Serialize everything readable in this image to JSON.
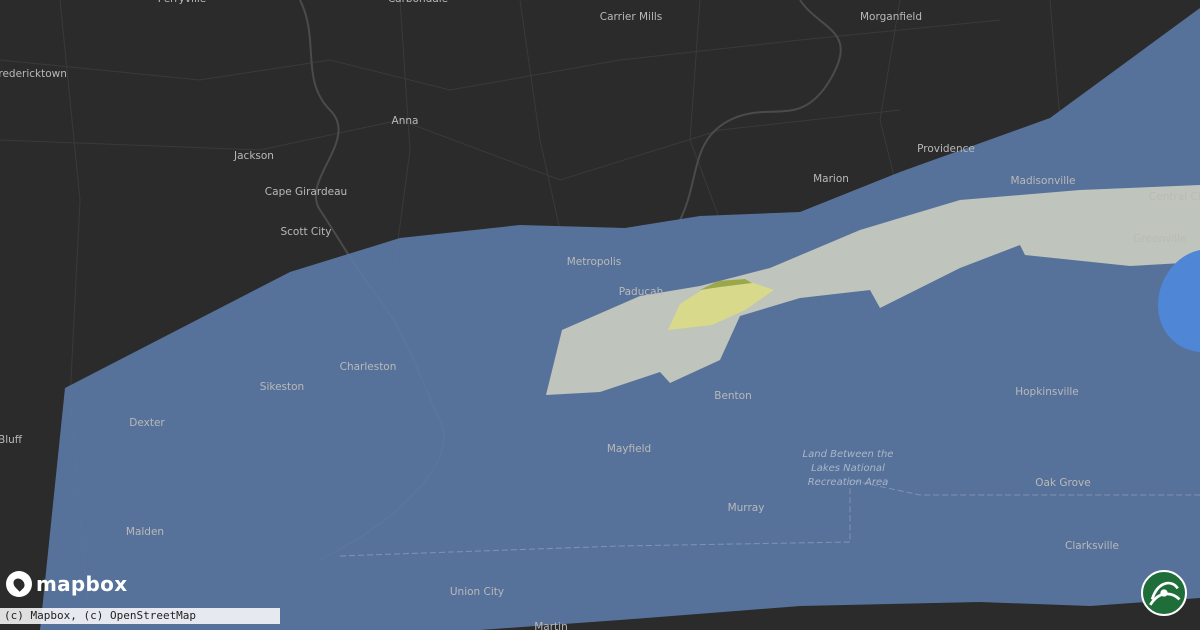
{
  "map": {
    "places": [
      {
        "id": "perryville",
        "label": "Perryville"
      },
      {
        "id": "carbondale",
        "label": "Carbondale"
      },
      {
        "id": "carrier-mills",
        "label": "Carrier Mills"
      },
      {
        "id": "morganfield",
        "label": "Morganfield"
      },
      {
        "id": "fredericktown",
        "label": "Fredericktown"
      },
      {
        "id": "anna",
        "label": "Anna"
      },
      {
        "id": "jackson",
        "label": "Jackson"
      },
      {
        "id": "cape-girardeau",
        "label": "Cape Girardeau"
      },
      {
        "id": "providence",
        "label": "Providence"
      },
      {
        "id": "marion",
        "label": "Marion"
      },
      {
        "id": "madisonville",
        "label": "Madisonville"
      },
      {
        "id": "central-city",
        "label": "Central City"
      },
      {
        "id": "scott-city",
        "label": "Scott City"
      },
      {
        "id": "metropolis",
        "label": "Metropolis"
      },
      {
        "id": "greenville",
        "label": "Greenville"
      },
      {
        "id": "paducah",
        "label": "Paducah"
      },
      {
        "id": "charleston",
        "label": "Charleston"
      },
      {
        "id": "sikeston",
        "label": "Sikeston"
      },
      {
        "id": "benton",
        "label": "Benton"
      },
      {
        "id": "hopkinsville",
        "label": "Hopkinsville"
      },
      {
        "id": "dexter",
        "label": "Dexter"
      },
      {
        "id": "bluff",
        "label": "Bluff"
      },
      {
        "id": "mayfield",
        "label": "Mayfield"
      },
      {
        "id": "oak-grove",
        "label": "Oak Grove"
      },
      {
        "id": "murray",
        "label": "Murray"
      },
      {
        "id": "malden",
        "label": "Malden"
      },
      {
        "id": "clarksville",
        "label": "Clarksville"
      },
      {
        "id": "union-city",
        "label": "Union City"
      },
      {
        "id": "martin",
        "label": "Martin"
      }
    ],
    "park_label": [
      "Land Between the",
      "Lakes National",
      "Recreation Area"
    ],
    "colors": {
      "background": "#2b2b2b",
      "outer_swath": "#5c7aa6",
      "inner_swath": "#c8ccbf",
      "core_swath": "#d8d98a",
      "core_tip": "#9aa84a",
      "edge_blob": "#4f86d6"
    }
  },
  "brand": {
    "logo_text": "mapbox",
    "logo_icon": "mapbox-pin-icon"
  },
  "attribution": "(c) Mapbox, (c) OpenStreetMap",
  "badge_icon": "hail-logo-icon"
}
